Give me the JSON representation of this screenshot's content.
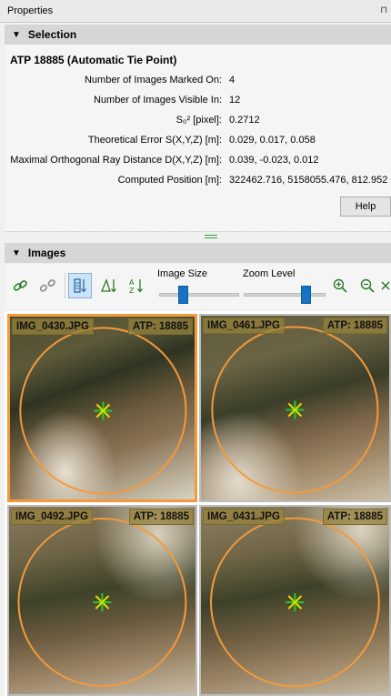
{
  "window": {
    "title": "Properties",
    "pin_icon": "pin-icon"
  },
  "selection": {
    "header": "Selection",
    "point_title": "ATP 18885 (Automatic Tie Point)",
    "rows": [
      {
        "label": "Number of Images Marked On:",
        "value": "4"
      },
      {
        "label": "Number of Images Visible In:",
        "value": "12"
      },
      {
        "label": "S₀² [pixel]:",
        "value": "0.2712"
      },
      {
        "label": "Theoretical Error S(X,Y,Z) [m]:",
        "value": "0.029, 0.017, 0.058"
      },
      {
        "label": "Maximal Orthogonal Ray Distance D(X,Y,Z) [m]:",
        "value": "0.039, -0.023, 0.012"
      },
      {
        "label": "Computed Position [m]:",
        "value": "322462.716, 5158055.476, 812.952"
      }
    ],
    "help_label": "Help"
  },
  "images": {
    "header": "Images",
    "toolbar": {
      "icons": [
        "link-icon",
        "unlink-icon",
        "sort-by-number-icon",
        "sort-by-angle-icon",
        "sort-alphabetical-icon",
        "zoom-in-icon",
        "zoom-out-icon",
        "fit-icon"
      ],
      "image_size_label": "Image Size",
      "zoom_level_label": "Zoom Level",
      "image_size_level": 0.3,
      "zoom_level_level": 0.75
    },
    "tiles": [
      {
        "name": "IMG_0430.JPG",
        "atp": "ATP: 18885",
        "selected": true
      },
      {
        "name": "IMG_0461.JPG",
        "atp": "ATP: 18885",
        "selected": false
      },
      {
        "name": "IMG_0492.JPG",
        "atp": "ATP: 18885",
        "selected": false
      },
      {
        "name": "IMG_0431.JPG",
        "atp": "ATP: 18885",
        "selected": false
      }
    ]
  },
  "colors": {
    "selected_border": "#f39a3c",
    "circle": "#f39a3c",
    "marker_green": "#22cc22",
    "marker_yellow": "#e8e000",
    "slider_thumb": "#1673c4"
  }
}
